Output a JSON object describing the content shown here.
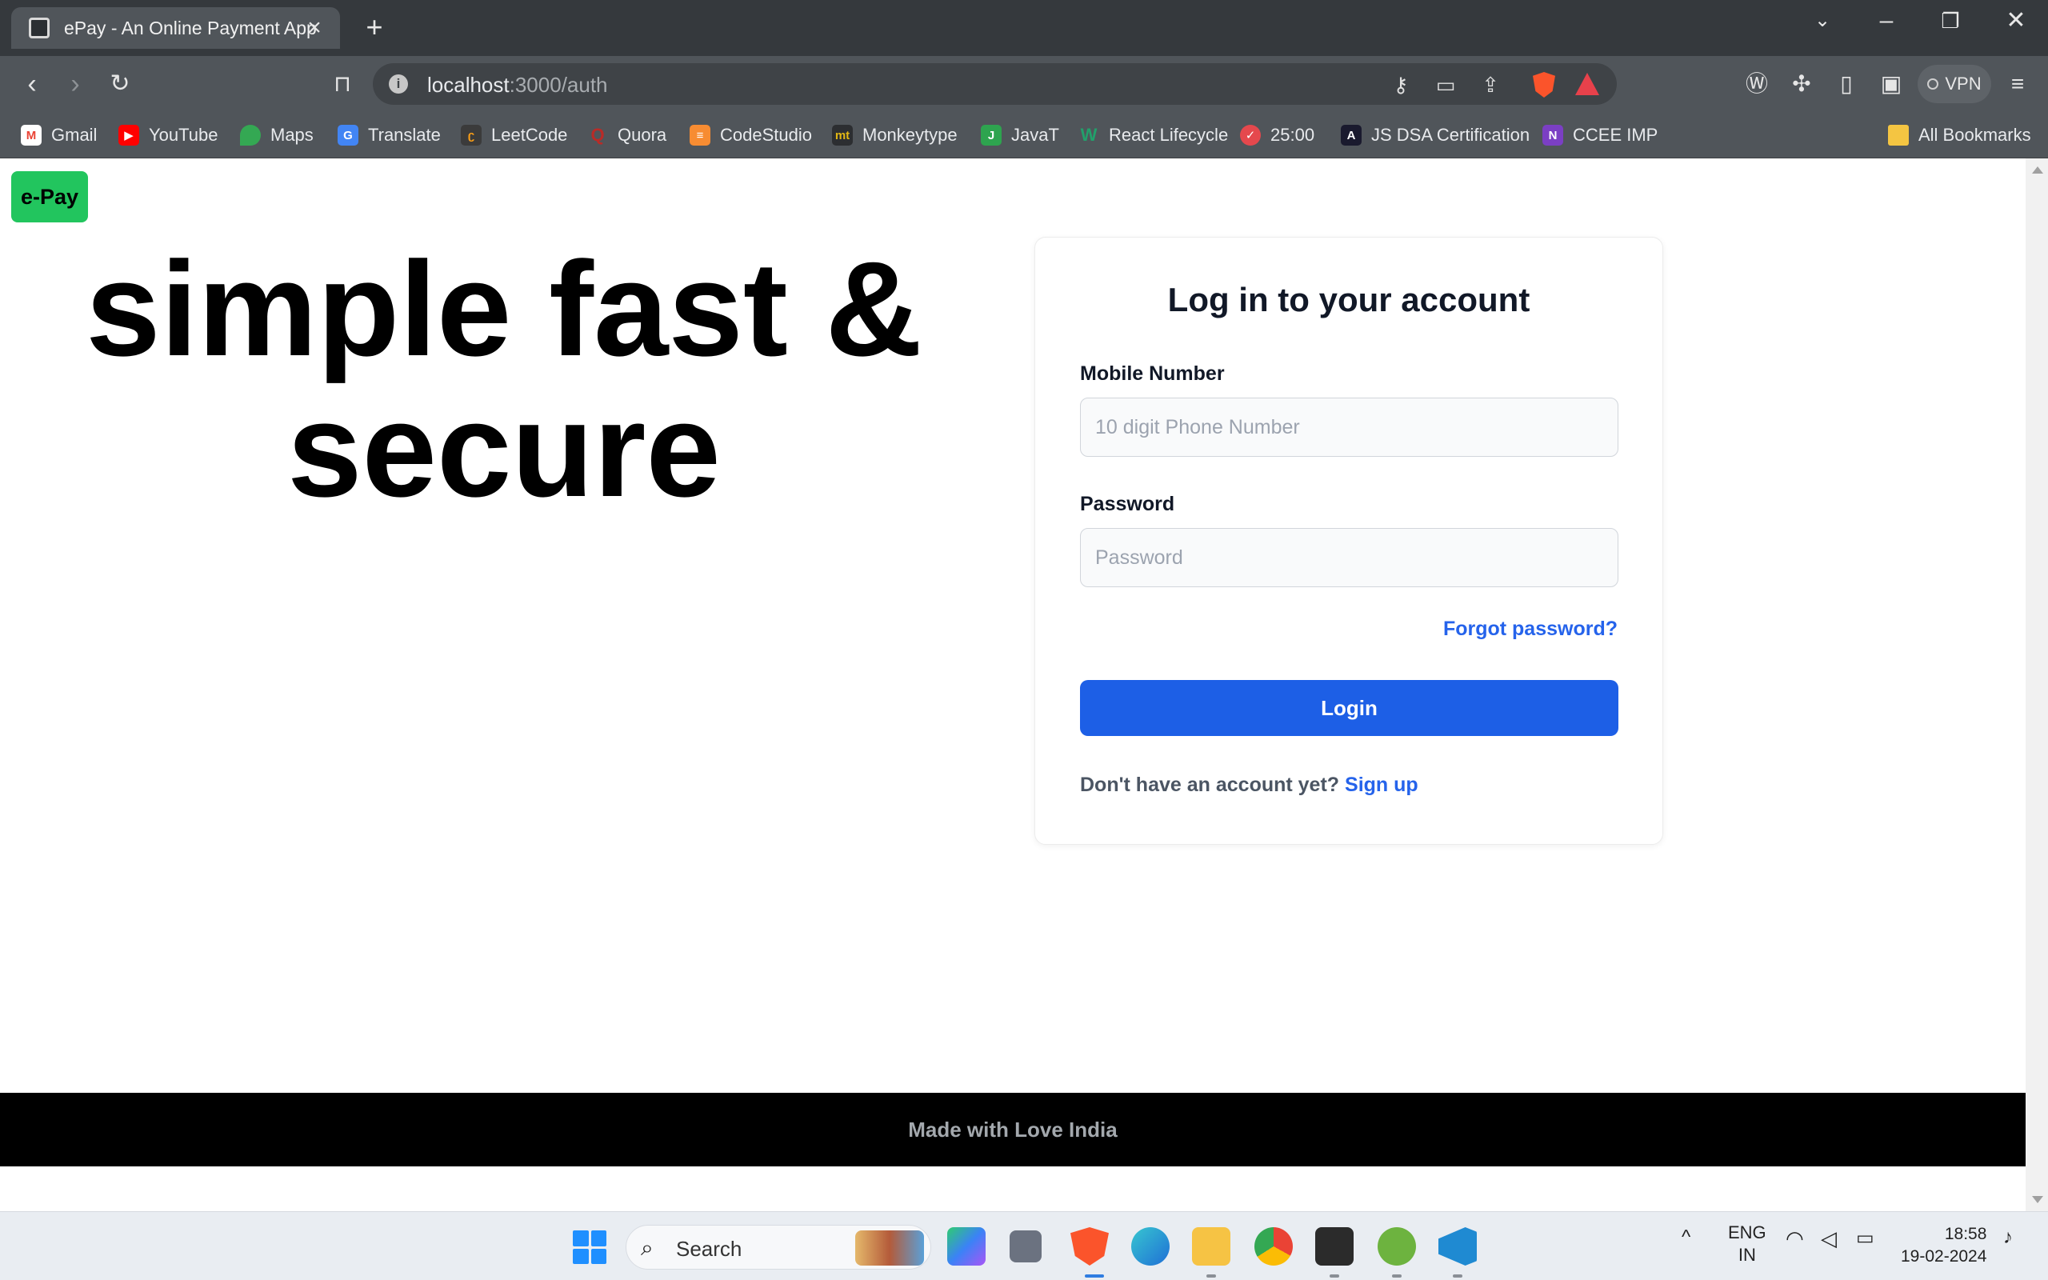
{
  "browser": {
    "tab_title": "ePay - An Online Payment App",
    "new_tab_symbol": "+",
    "url_host": "localhost",
    "url_path": ":3000/auth",
    "vpn_label": "VPN",
    "bookmarks": [
      "Gmail",
      "YouTube",
      "Maps",
      "Translate",
      "LeetCode",
      "Quora",
      "CodeStudio",
      "Monkeytype",
      "JavaT",
      "React Lifecycle",
      "25:00",
      "JS DSA Certification",
      "CCEE IMP"
    ],
    "all_bookmarks": "All Bookmarks"
  },
  "page": {
    "logo": "e-Pay",
    "hero_line1": "simple fast &",
    "hero_line2": "secure",
    "login": {
      "title": "Log in to your account",
      "mobile_label": "Mobile Number",
      "mobile_placeholder": "10 digit Phone Number",
      "password_label": "Password",
      "password_placeholder": "Password",
      "forgot": "Forgot password?",
      "button": "Login",
      "no_account": "Don't have an account yet?",
      "signup": "Sign up"
    },
    "footer": "Made with Love India"
  },
  "taskbar": {
    "search_label": "Search",
    "language": "ENG",
    "region": "IN",
    "time": "18:58",
    "date": "19-02-2024"
  },
  "colors": {
    "logo_bg": "#22c55e",
    "login_button": "#1d5fe6",
    "link": "#2563eb",
    "footer_bg": "#000000"
  }
}
